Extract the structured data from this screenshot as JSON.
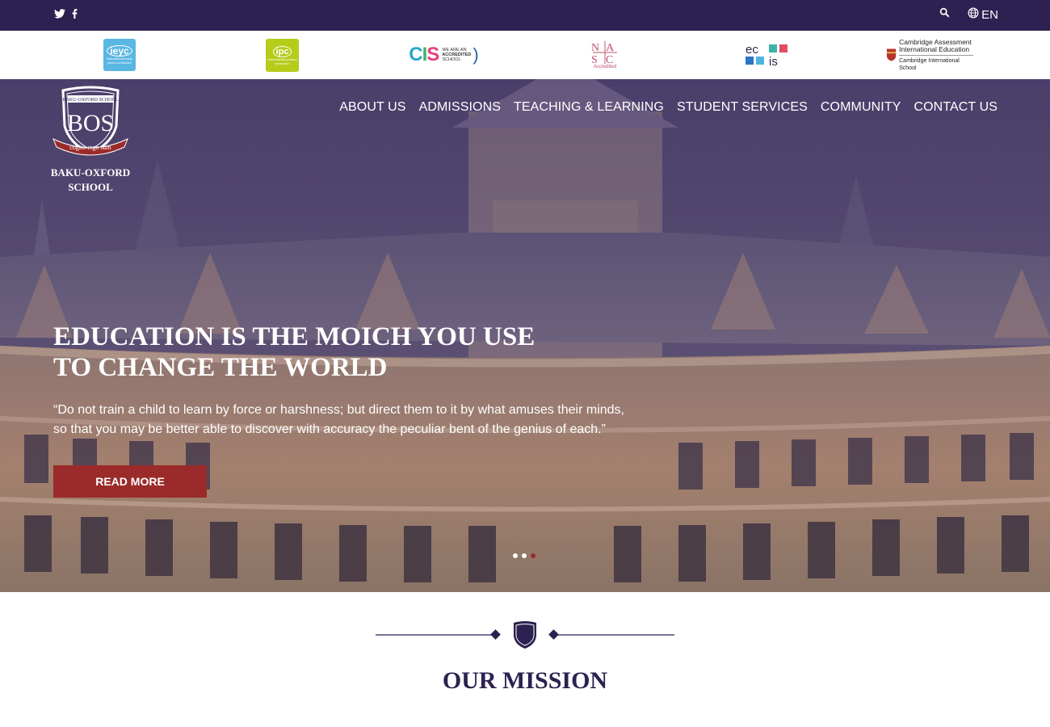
{
  "topbar": {
    "social": [
      "twitter-icon",
      "facebook-icon"
    ],
    "search_icon": "search-icon",
    "language": "EN"
  },
  "accreditations": [
    {
      "name": "ieyc",
      "big": "ieyc",
      "small": "international early years curriculum"
    },
    {
      "name": "ipc",
      "big": "ipc",
      "small": "international primary curriculum"
    },
    {
      "name": "cis",
      "letters": "CIS",
      "text1": "WE ARE AN",
      "text2": "ACCREDITED",
      "text3": "SCHOOL"
    },
    {
      "name": "neasc",
      "big": "NEASC",
      "small": "Accredited"
    },
    {
      "name": "ecis",
      "letters": "ecis"
    },
    {
      "name": "cambridge",
      "line1": "Cambridge Assessment",
      "line2": "International Education",
      "sub": "Cambridge International School"
    }
  ],
  "brand": {
    "crest_top": "BAKU-OXFORD SCHOOL",
    "crest_letters": "BOS",
    "crest_motto": "cogito ergo sum",
    "name_line1": "BAKU-OXFORD",
    "name_line2": "SCHOOL"
  },
  "nav": [
    "ABOUT US",
    "ADMISSIONS",
    "TEACHING & LEARNING",
    "STUDENT SERVICES",
    "COMMUNITY",
    "CONTACT US"
  ],
  "hero": {
    "headline_line1": "EDUCATION IS THE MOICH YOU USE",
    "headline_line2": "TO CHANGE THE WORLD",
    "quote_line1": "“Do not train a child to learn by force or harshness; but direct them to it by what amuses their minds,",
    "quote_line2": "so that you may be better able to discover with accuracy the peculiar bent of the genius of each.”",
    "cta": "READ MORE",
    "slides": 3,
    "active_slide": 3
  },
  "mission": {
    "title": "OUR MISSION"
  },
  "colors": {
    "brand_purple": "#2c2150",
    "accent_red": "#9b2a2a"
  }
}
